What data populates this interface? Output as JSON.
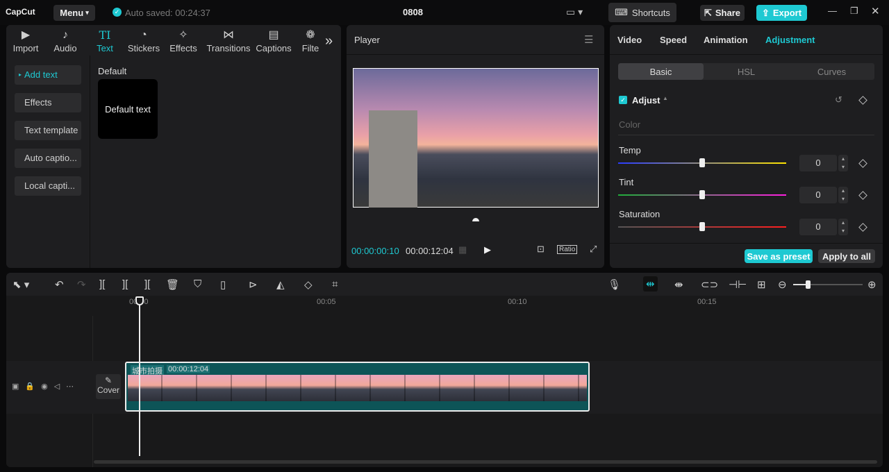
{
  "app": {
    "logo": "CapCut",
    "menu": "Menu",
    "autosave": "Auto saved: 00:24:37",
    "project": "0808",
    "shortcuts": "Shortcuts",
    "share": "Share",
    "export": "Export"
  },
  "left": {
    "tabs": [
      {
        "label": "Import",
        "icon": "▶"
      },
      {
        "label": "Audio",
        "icon": "♪"
      },
      {
        "label": "Text",
        "icon": "TI"
      },
      {
        "label": "Stickers",
        "icon": "◔"
      },
      {
        "label": "Effects",
        "icon": "✧"
      },
      {
        "label": "Transitions",
        "icon": "⋈"
      },
      {
        "label": "Captions",
        "icon": "▤"
      },
      {
        "label": "Filte",
        "icon": "❁"
      }
    ],
    "more": "»",
    "sidebar": [
      "Add text",
      "Effects",
      "Text template",
      "Auto captio...",
      "Local capti..."
    ],
    "section": "Default",
    "card": "Default text"
  },
  "player": {
    "title": "Player",
    "current": "00:00:00:10",
    "total": "00:00:12:04",
    "ratio": "Ratio"
  },
  "right": {
    "tabs": [
      "Video",
      "Speed",
      "Animation",
      "Adjustment"
    ],
    "subtabs": [
      "Basic",
      "HSL",
      "Curves"
    ],
    "adjust": "Adjust",
    "color": "Color",
    "sliders": [
      {
        "label": "Temp",
        "value": "0",
        "level": 0.5
      },
      {
        "label": "Tint",
        "value": "0",
        "level": 0.5
      },
      {
        "label": "Saturation",
        "value": "0",
        "level": 0.5
      }
    ],
    "save_preset": "Save as preset",
    "apply_all": "Apply to all"
  },
  "timeline": {
    "ticks": [
      "00:00",
      "00:05",
      "00:10",
      "00:15"
    ],
    "clip_name": "城市拍摄",
    "clip_duration": "00:00:12:04",
    "cover": "Cover"
  },
  "colors": {
    "accent": "#1ec9d2",
    "clip": "#0d5457"
  }
}
